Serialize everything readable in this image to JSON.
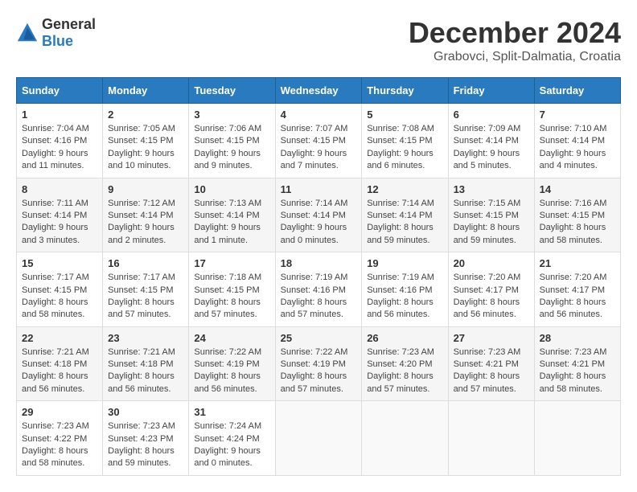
{
  "header": {
    "logo_general": "General",
    "logo_blue": "Blue",
    "title": "December 2024",
    "subtitle": "Grabovci, Split-Dalmatia, Croatia"
  },
  "weekdays": [
    "Sunday",
    "Monday",
    "Tuesday",
    "Wednesday",
    "Thursday",
    "Friday",
    "Saturday"
  ],
  "weeks": [
    [
      {
        "day": "1",
        "sunrise": "7:04 AM",
        "sunset": "4:16 PM",
        "daylight": "9 hours and 11 minutes."
      },
      {
        "day": "2",
        "sunrise": "7:05 AM",
        "sunset": "4:15 PM",
        "daylight": "9 hours and 10 minutes."
      },
      {
        "day": "3",
        "sunrise": "7:06 AM",
        "sunset": "4:15 PM",
        "daylight": "9 hours and 9 minutes."
      },
      {
        "day": "4",
        "sunrise": "7:07 AM",
        "sunset": "4:15 PM",
        "daylight": "9 hours and 7 minutes."
      },
      {
        "day": "5",
        "sunrise": "7:08 AM",
        "sunset": "4:15 PM",
        "daylight": "9 hours and 6 minutes."
      },
      {
        "day": "6",
        "sunrise": "7:09 AM",
        "sunset": "4:14 PM",
        "daylight": "9 hours and 5 minutes."
      },
      {
        "day": "7",
        "sunrise": "7:10 AM",
        "sunset": "4:14 PM",
        "daylight": "9 hours and 4 minutes."
      }
    ],
    [
      {
        "day": "8",
        "sunrise": "7:11 AM",
        "sunset": "4:14 PM",
        "daylight": "9 hours and 3 minutes."
      },
      {
        "day": "9",
        "sunrise": "7:12 AM",
        "sunset": "4:14 PM",
        "daylight": "9 hours and 2 minutes."
      },
      {
        "day": "10",
        "sunrise": "7:13 AM",
        "sunset": "4:14 PM",
        "daylight": "9 hours and 1 minute."
      },
      {
        "day": "11",
        "sunrise": "7:14 AM",
        "sunset": "4:14 PM",
        "daylight": "9 hours and 0 minutes."
      },
      {
        "day": "12",
        "sunrise": "7:14 AM",
        "sunset": "4:14 PM",
        "daylight": "8 hours and 59 minutes."
      },
      {
        "day": "13",
        "sunrise": "7:15 AM",
        "sunset": "4:15 PM",
        "daylight": "8 hours and 59 minutes."
      },
      {
        "day": "14",
        "sunrise": "7:16 AM",
        "sunset": "4:15 PM",
        "daylight": "8 hours and 58 minutes."
      }
    ],
    [
      {
        "day": "15",
        "sunrise": "7:17 AM",
        "sunset": "4:15 PM",
        "daylight": "8 hours and 58 minutes."
      },
      {
        "day": "16",
        "sunrise": "7:17 AM",
        "sunset": "4:15 PM",
        "daylight": "8 hours and 57 minutes."
      },
      {
        "day": "17",
        "sunrise": "7:18 AM",
        "sunset": "4:15 PM",
        "daylight": "8 hours and 57 minutes."
      },
      {
        "day": "18",
        "sunrise": "7:19 AM",
        "sunset": "4:16 PM",
        "daylight": "8 hours and 57 minutes."
      },
      {
        "day": "19",
        "sunrise": "7:19 AM",
        "sunset": "4:16 PM",
        "daylight": "8 hours and 56 minutes."
      },
      {
        "day": "20",
        "sunrise": "7:20 AM",
        "sunset": "4:17 PM",
        "daylight": "8 hours and 56 minutes."
      },
      {
        "day": "21",
        "sunrise": "7:20 AM",
        "sunset": "4:17 PM",
        "daylight": "8 hours and 56 minutes."
      }
    ],
    [
      {
        "day": "22",
        "sunrise": "7:21 AM",
        "sunset": "4:18 PM",
        "daylight": "8 hours and 56 minutes."
      },
      {
        "day": "23",
        "sunrise": "7:21 AM",
        "sunset": "4:18 PM",
        "daylight": "8 hours and 56 minutes."
      },
      {
        "day": "24",
        "sunrise": "7:22 AM",
        "sunset": "4:19 PM",
        "daylight": "8 hours and 56 minutes."
      },
      {
        "day": "25",
        "sunrise": "7:22 AM",
        "sunset": "4:19 PM",
        "daylight": "8 hours and 57 minutes."
      },
      {
        "day": "26",
        "sunrise": "7:23 AM",
        "sunset": "4:20 PM",
        "daylight": "8 hours and 57 minutes."
      },
      {
        "day": "27",
        "sunrise": "7:23 AM",
        "sunset": "4:21 PM",
        "daylight": "8 hours and 57 minutes."
      },
      {
        "day": "28",
        "sunrise": "7:23 AM",
        "sunset": "4:21 PM",
        "daylight": "8 hours and 58 minutes."
      }
    ],
    [
      {
        "day": "29",
        "sunrise": "7:23 AM",
        "sunset": "4:22 PM",
        "daylight": "8 hours and 58 minutes."
      },
      {
        "day": "30",
        "sunrise": "7:23 AM",
        "sunset": "4:23 PM",
        "daylight": "8 hours and 59 minutes."
      },
      {
        "day": "31",
        "sunrise": "7:24 AM",
        "sunset": "4:24 PM",
        "daylight": "9 hours and 0 minutes."
      },
      null,
      null,
      null,
      null
    ]
  ]
}
